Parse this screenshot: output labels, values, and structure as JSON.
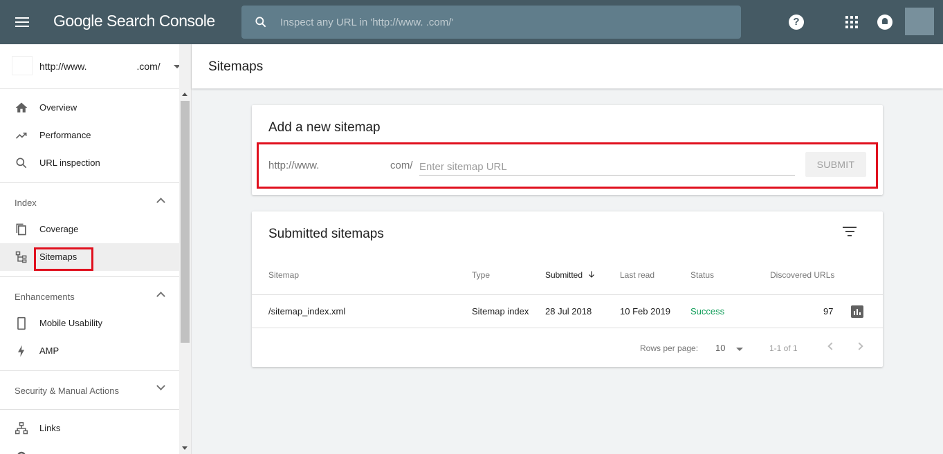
{
  "app": {
    "title": "Google Search Console"
  },
  "search": {
    "placeholder": "Inspect any URL in 'http://www.                  .com/'"
  },
  "property": {
    "prefix": "http://www.",
    "suffix": ".com/"
  },
  "sidebar": {
    "items": [
      {
        "label": "Overview",
        "icon": "home-icon"
      },
      {
        "label": "Performance",
        "icon": "trending-up-icon"
      },
      {
        "label": "URL inspection",
        "icon": "search-icon"
      }
    ],
    "index_header": "Index",
    "index_items": [
      {
        "label": "Coverage",
        "icon": "coverage-icon"
      },
      {
        "label": "Sitemaps",
        "icon": "sitemap-icon",
        "active": true
      }
    ],
    "enhancements_header": "Enhancements",
    "enhancement_items": [
      {
        "label": "Mobile Usability",
        "icon": "phone-icon"
      },
      {
        "label": "AMP",
        "icon": "lightning-icon"
      }
    ],
    "security_header": "Security & Manual Actions",
    "bottom_items": [
      {
        "label": "Links",
        "icon": "links-icon"
      }
    ]
  },
  "page": {
    "title": "Sitemaps"
  },
  "add_sitemap": {
    "title": "Add a new sitemap",
    "prefix": "http://www.",
    "suffix": "com/",
    "placeholder": "Enter sitemap URL",
    "submit_label": "SUBMIT"
  },
  "submitted": {
    "title": "Submitted sitemaps",
    "columns": [
      "Sitemap",
      "Type",
      "Submitted",
      "Last read",
      "Status",
      "Discovered URLs"
    ],
    "rows": [
      {
        "sitemap": "/sitemap_index.xml",
        "type": "Sitemap index",
        "submitted": "28 Jul 2018",
        "last_read": "10 Feb 2019",
        "status": "Success",
        "discovered": "97"
      }
    ],
    "rows_per_page_label": "Rows per page:",
    "rows_per_page": "10",
    "range": "1-1 of 1"
  },
  "colors": {
    "topbar": "#455a64",
    "success": "#0f9d58",
    "highlight": "#e0101e"
  }
}
